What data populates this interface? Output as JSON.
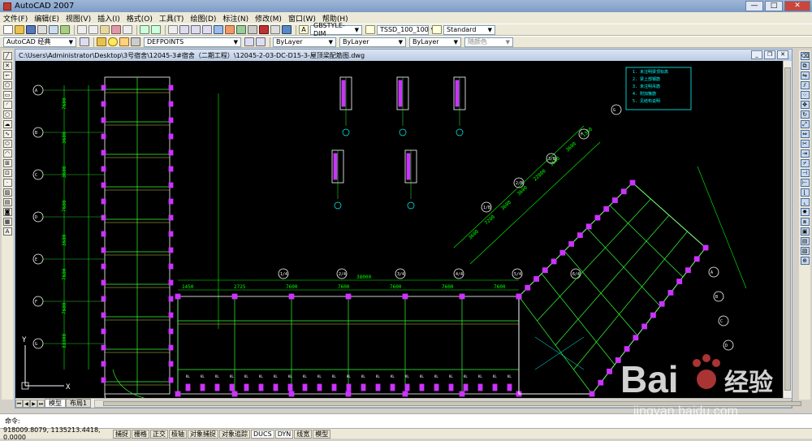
{
  "window": {
    "title": "AutoCAD 2007"
  },
  "menu": [
    "文件(F)",
    "编辑(E)",
    "视图(V)",
    "插入(I)",
    "格式(O)",
    "工具(T)",
    "绘图(D)",
    "标注(N)",
    "修改(M)",
    "窗口(W)",
    "帮助(H)"
  ],
  "toolbar1": {
    "text_style": "GBSTYLE-DIM",
    "dim_style": "TSSD_100_100",
    "table_style": "Standard"
  },
  "toolbar2": {
    "workspace": "AutoCAD 经典",
    "layer": "DEFPOINTS",
    "color": "ByLayer",
    "linetype": "ByLayer",
    "lineweight": "ByLayer",
    "plotstyle": "随颜色"
  },
  "document": {
    "title": "C:\\Users\\Administrator\\Desktop\\3号宿舍\\12045-3#宿舍（二期工程）\\12045-2-03-DC-D15-3-屋顶梁配筋图.dwg"
  },
  "drawing": {
    "dims_top": [
      "1450",
      "2725",
      "7600",
      "7600",
      "7600",
      "7600",
      "7600"
    ],
    "dim_total": "38000",
    "dims_left": [
      "7600",
      "3600",
      "3600",
      "7600",
      "3600",
      "7600",
      "7600",
      "33300"
    ],
    "dims_diag": [
      "3600",
      "7200",
      "3600",
      "3600",
      "22800",
      "3600",
      "3600",
      "1350"
    ],
    "axis_bubbles": [
      "1/4",
      "2/4",
      "3/4",
      "4/4",
      "5/4",
      "6/4",
      "A",
      "B",
      "C",
      "D",
      "E",
      "F",
      "G",
      "1/B",
      "2/B",
      "3/B"
    ],
    "ucs_x": "X",
    "ucs_y": "Y",
    "notes": [
      "1. 未注明梁顶标高",
      "2. 梁上部钢筋",
      "3. 未注明吊筋",
      "4. 附加箍筋",
      "5. 见结构说明"
    ]
  },
  "tabs": {
    "model": "模型",
    "layout": "布局1"
  },
  "command": {
    "prompt": "命令:"
  },
  "status": {
    "coords": "918009.8079, 1135213.4418, 0.0000",
    "toggles": [
      "捕捉",
      "栅格",
      "正交",
      "极轴",
      "对象捕捉",
      "对象追踪",
      "DUCS",
      "DYN",
      "线宽",
      "模型"
    ]
  },
  "watermark": {
    "brand": "Bai",
    "brand_cn": "经验",
    "url": "jingyan.baidu.com"
  },
  "colors": {
    "canvas": "#000000",
    "grid": "#33ff33",
    "beam": "#ffffff",
    "dim": "#00ff00",
    "column": "#cc33ff",
    "accent": "#00ffff"
  }
}
